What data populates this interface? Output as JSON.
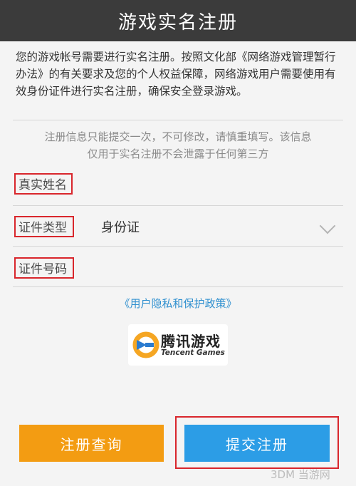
{
  "header": {
    "title": "游戏实名注册"
  },
  "intro": {
    "text": "您的游戏帐号需要进行实名注册。按照文化部《网络游戏管理暂行办法》的有关要求及您的个人权益保障，网络游戏用户需要使用有效身份证件进行实名注册，确保安全登录游戏。"
  },
  "notice": {
    "line1": "注册信息只能提交一次，不可修改，请慎重填写。该信息",
    "line2": "仅用于实名注册不会泄露于任何第三方"
  },
  "form": {
    "real_name_label": "真实姓名",
    "id_type_label": "证件类型",
    "id_type_value": "身份证",
    "id_number_label": "证件号码"
  },
  "privacy_link": "《用户隐私和保护政策》",
  "logo": {
    "cn": "腾讯游戏",
    "en": "Tencent Games"
  },
  "buttons": {
    "query": "注册查询",
    "submit": "提交注册"
  },
  "watermark": "3DM 当游网",
  "colors": {
    "header_bg": "#3b3b3b",
    "query": "#f39c12",
    "submit": "#2c9de6",
    "link": "#2e8fcf",
    "highlight": "#d9262c"
  }
}
